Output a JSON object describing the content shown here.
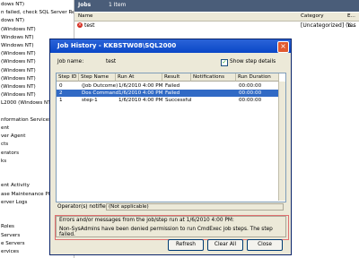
{
  "tree": {
    "items": [
      "dows NT)",
      "n failed, check SQL Server Req",
      "dows NT)",
      "(Windows NT)",
      "Windows NT)",
      "Windows NT)",
      "(Windows NT)",
      "(Windows NT)",
      "(Windows NT)",
      "(Windows NT)",
      "(Windows NT)",
      "(Windows NT)",
      "L2000 (Windows NT)",
      "",
      "nformation Services",
      "ent",
      "ver Agent",
      "cts",
      "erators",
      "ks",
      "",
      "",
      "ent Activity",
      "ase Maintenance Plans",
      "erver Logs",
      "",
      "",
      "Roles",
      "Servers",
      "e Servers",
      "ervices"
    ]
  },
  "jobs": {
    "header": "Jobs",
    "count": "1 Item",
    "columns": {
      "name": "Name",
      "category": "Category",
      "enabled": "E..."
    },
    "row": {
      "name": "test",
      "category": "[Uncategorized] (L...",
      "enabled": "Yes"
    }
  },
  "dialog": {
    "title": "Job History - KKBSTW08\\SQL2000",
    "close": "×",
    "job_name_label": "Job name:",
    "job_name_value": "test",
    "show_steps_label": "Show step details",
    "show_steps_checked": "✓",
    "grid": {
      "columns": [
        "Step ID",
        "Step Name",
        "Run At",
        "Result",
        "Notifications",
        "Run Duration"
      ],
      "rows": [
        {
          "id": "0",
          "name": "(Job Outcome)",
          "run_at": "1/6/2010  4:00 PM",
          "result": "Failed",
          "notifications": "",
          "duration": "00:00:00"
        },
        {
          "id": "2",
          "name": "Dos Command",
          "run_at": "1/6/2010  4:00 PM",
          "result": "Failed",
          "notifications": "",
          "duration": "00:00:00"
        },
        {
          "id": "1",
          "name": "step-1",
          "run_at": "1/6/2010  4:00 PM",
          "result": "Successful",
          "notifications": "",
          "duration": "00:00:00"
        }
      ],
      "selected_index": 1
    },
    "operators_label": "Operator(s) notified:",
    "operators_value": "(Not applicable)",
    "errors_label": "Errors and/or messages from the job/step run at 1/6/2010  4:00 PM:",
    "errors_message": "Non-SysAdmins have been denied permission to run CmdExec job steps.  The step failed.",
    "buttons": {
      "refresh": "Refresh",
      "clear_all": "Clear All",
      "close": "Close"
    }
  }
}
